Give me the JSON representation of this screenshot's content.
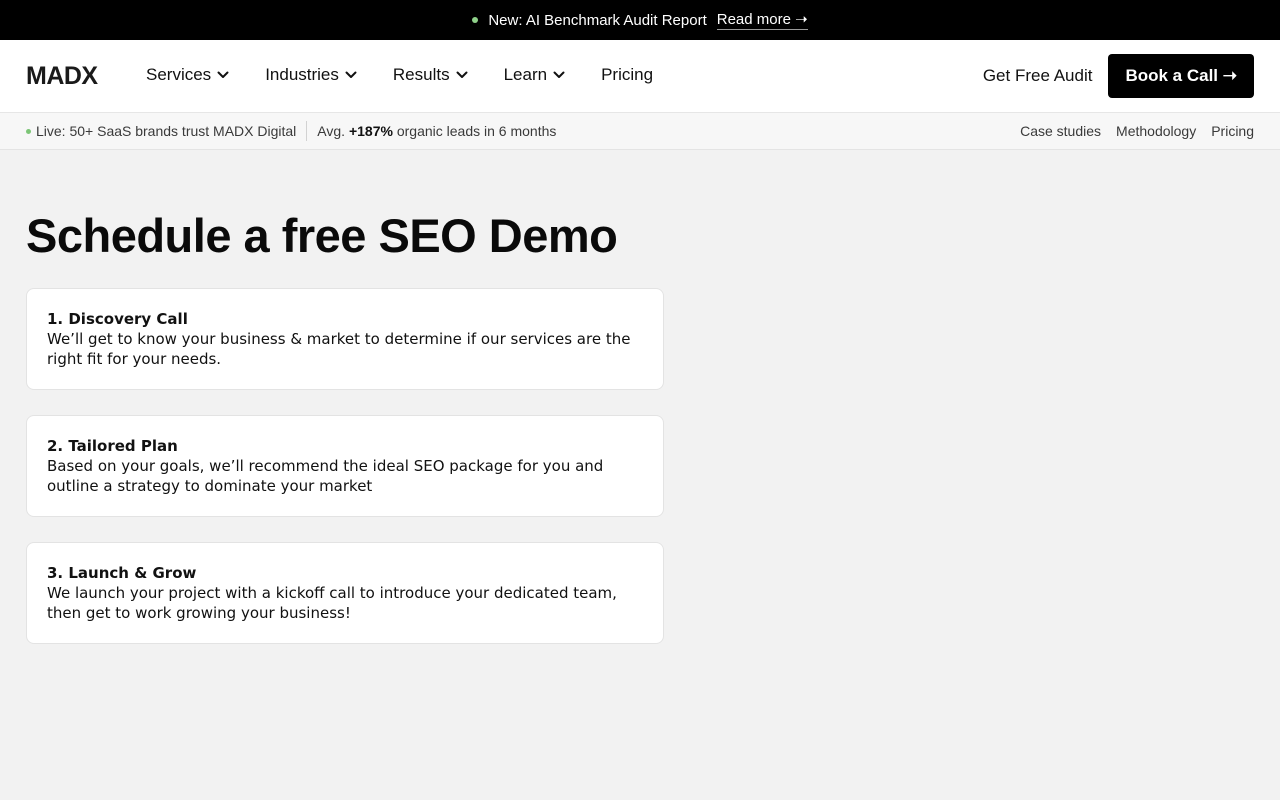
{
  "announcement": {
    "text": "New: AI Benchmark Audit Report",
    "link": "Read more ➝"
  },
  "nav": {
    "logo": "MADX",
    "items": [
      {
        "label": "Services",
        "dropdown": true
      },
      {
        "label": "Industries",
        "dropdown": true
      },
      {
        "label": "Results",
        "dropdown": true
      },
      {
        "label": "Learn",
        "dropdown": true
      },
      {
        "label": "Pricing",
        "dropdown": false
      }
    ],
    "audit_link": "Get Free Audit",
    "cta": "Book a Call ➝"
  },
  "subbar": {
    "live_text": "Live: 50+ SaaS brands trust MADX Digital",
    "avg_prefix": "Avg.",
    "avg_value": "+187%",
    "avg_suffix": "organic leads in 6 months",
    "links": [
      "Case studies",
      "Methodology",
      "Pricing"
    ]
  },
  "main": {
    "title": "Schedule a free SEO Demo",
    "steps": [
      {
        "title": "1. Discovery Call",
        "text": "We’ll get to know your business & market to determine if our services are the right fit for your needs."
      },
      {
        "title": "2. Tailored Plan",
        "text": "Based on your goals, we’ll recommend the ideal SEO package for you and outline a strategy to dominate your market"
      },
      {
        "title": "3. Launch & Grow",
        "text": "We launch your project with a kickoff call to introduce your dedicated team, then get to work growing your business!"
      }
    ]
  },
  "colors": {
    "accent_dot": "#8fd18a",
    "cta_bg": "#000000",
    "page_bg": "#f2f2f2"
  }
}
